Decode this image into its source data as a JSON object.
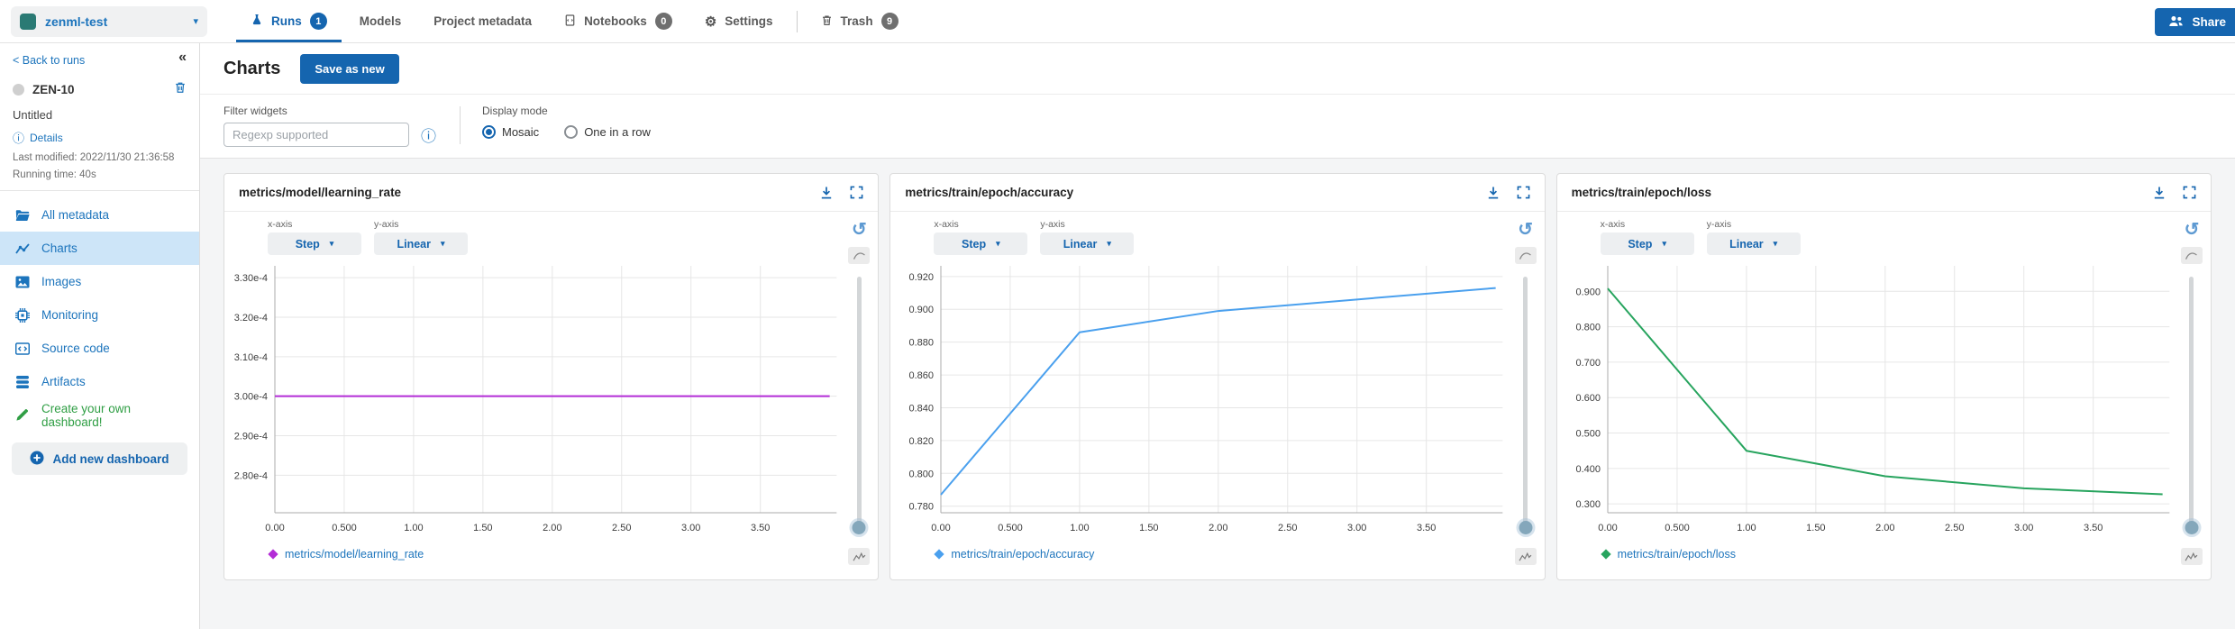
{
  "topbar": {
    "project_name": "zenml-test",
    "tabs": [
      {
        "label": "Runs",
        "badge": "1"
      },
      {
        "label": "Models"
      },
      {
        "label": "Project metadata"
      },
      {
        "label": "Notebooks",
        "badge": "0"
      },
      {
        "label": "Settings"
      },
      {
        "label": "Trash",
        "badge": "9"
      }
    ],
    "share_label": "Share"
  },
  "sidebar": {
    "back_link": "< Back to runs",
    "run": {
      "id": "ZEN-10",
      "title": "Untitled",
      "details_label": "Details",
      "last_modified": "Last modified: 2022/11/30 21:36:58",
      "running_time": "Running time: 40s"
    },
    "items": [
      {
        "label": "All metadata",
        "active": false
      },
      {
        "label": "Charts",
        "active": true
      },
      {
        "label": "Images",
        "active": false
      },
      {
        "label": "Monitoring",
        "active": false
      },
      {
        "label": "Source code",
        "active": false
      },
      {
        "label": "Artifacts",
        "active": false
      }
    ],
    "create_dashboard_label": "Create your own dashboard!",
    "add_dashboard_label": "Add new dashboard"
  },
  "main": {
    "title": "Charts",
    "save_button": "Save as new",
    "filter": {
      "label": "Filter widgets",
      "placeholder": "Regexp supported"
    },
    "display_mode": {
      "label": "Display mode",
      "options": [
        {
          "label": "Mosaic",
          "selected": true
        },
        {
          "label": "One in a row",
          "selected": false
        }
      ]
    }
  },
  "chart_controls": {
    "x_axis_label": "x-axis",
    "y_axis_label": "y-axis",
    "x_axis_value": "Step",
    "y_axis_value": "Linear"
  },
  "chart_data": [
    {
      "type": "line",
      "title": "metrics/model/learning_rate",
      "xlim": [
        0,
        4.05
      ],
      "ylim": [
        0.0002705,
        0.000333
      ],
      "x_ticks": [
        {
          "label": "0.00",
          "value": 0
        },
        {
          "label": "0.500",
          "value": 0.5
        },
        {
          "label": "1.00",
          "value": 1
        },
        {
          "label": "1.50",
          "value": 1.5
        },
        {
          "label": "2.00",
          "value": 2
        },
        {
          "label": "2.50",
          "value": 2.5
        },
        {
          "label": "3.00",
          "value": 3
        },
        {
          "label": "3.50",
          "value": 3.5
        }
      ],
      "y_ticks": [
        {
          "label": "3.30e-4",
          "value": 0.00033
        },
        {
          "label": "3.20e-4",
          "value": 0.00032
        },
        {
          "label": "3.10e-4",
          "value": 0.00031
        },
        {
          "label": "3.00e-4",
          "value": 0.0003
        },
        {
          "label": "2.90e-4",
          "value": 0.00029
        },
        {
          "label": "2.80e-4",
          "value": 0.00028
        }
      ],
      "series": [
        {
          "name": "metrics/model/learning_rate",
          "color": "#b32cd6",
          "points": [
            [
              0,
              0.0003
            ],
            [
              1,
              0.0003
            ],
            [
              2,
              0.0003
            ],
            [
              3,
              0.0003
            ],
            [
              4,
              0.0003
            ]
          ]
        }
      ]
    },
    {
      "type": "line",
      "title": "metrics/train/epoch/accuracy",
      "xlim": [
        0,
        4.05
      ],
      "ylim": [
        0.776,
        0.9265
      ],
      "x_ticks": [
        {
          "label": "0.00",
          "value": 0
        },
        {
          "label": "0.500",
          "value": 0.5
        },
        {
          "label": "1.00",
          "value": 1
        },
        {
          "label": "1.50",
          "value": 1.5
        },
        {
          "label": "2.00",
          "value": 2
        },
        {
          "label": "2.50",
          "value": 2.5
        },
        {
          "label": "3.00",
          "value": 3
        },
        {
          "label": "3.50",
          "value": 3.5
        }
      ],
      "y_ticks": [
        {
          "label": "0.920",
          "value": 0.92
        },
        {
          "label": "0.900",
          "value": 0.9
        },
        {
          "label": "0.880",
          "value": 0.88
        },
        {
          "label": "0.860",
          "value": 0.86
        },
        {
          "label": "0.840",
          "value": 0.84
        },
        {
          "label": "0.820",
          "value": 0.82
        },
        {
          "label": "0.800",
          "value": 0.8
        },
        {
          "label": "0.780",
          "value": 0.78
        }
      ],
      "series": [
        {
          "name": "metrics/train/epoch/accuracy",
          "color": "#4aa0ee",
          "points": [
            [
              0,
              0.787
            ],
            [
              1,
              0.886
            ],
            [
              2,
              0.899
            ],
            [
              3,
              0.906
            ],
            [
              4,
              0.913
            ]
          ]
        }
      ]
    },
    {
      "type": "line",
      "title": "metrics/train/epoch/loss",
      "xlim": [
        0,
        4.05
      ],
      "ylim": [
        0.275,
        0.972
      ],
      "x_ticks": [
        {
          "label": "0.00",
          "value": 0
        },
        {
          "label": "0.500",
          "value": 0.5
        },
        {
          "label": "1.00",
          "value": 1
        },
        {
          "label": "1.50",
          "value": 1.5
        },
        {
          "label": "2.00",
          "value": 2
        },
        {
          "label": "2.50",
          "value": 2.5
        },
        {
          "label": "3.00",
          "value": 3
        },
        {
          "label": "3.50",
          "value": 3.5
        }
      ],
      "y_ticks": [
        {
          "label": "0.900",
          "value": 0.9
        },
        {
          "label": "0.800",
          "value": 0.8
        },
        {
          "label": "0.700",
          "value": 0.7
        },
        {
          "label": "0.600",
          "value": 0.6
        },
        {
          "label": "0.500",
          "value": 0.5
        },
        {
          "label": "0.400",
          "value": 0.4
        },
        {
          "label": "0.300",
          "value": 0.3
        }
      ],
      "series": [
        {
          "name": "metrics/train/epoch/loss",
          "color": "#27a45e",
          "points": [
            [
              0,
              0.908
            ],
            [
              1,
              0.45
            ],
            [
              2,
              0.378
            ],
            [
              3,
              0.344
            ],
            [
              4,
              0.327
            ]
          ]
        }
      ]
    }
  ]
}
